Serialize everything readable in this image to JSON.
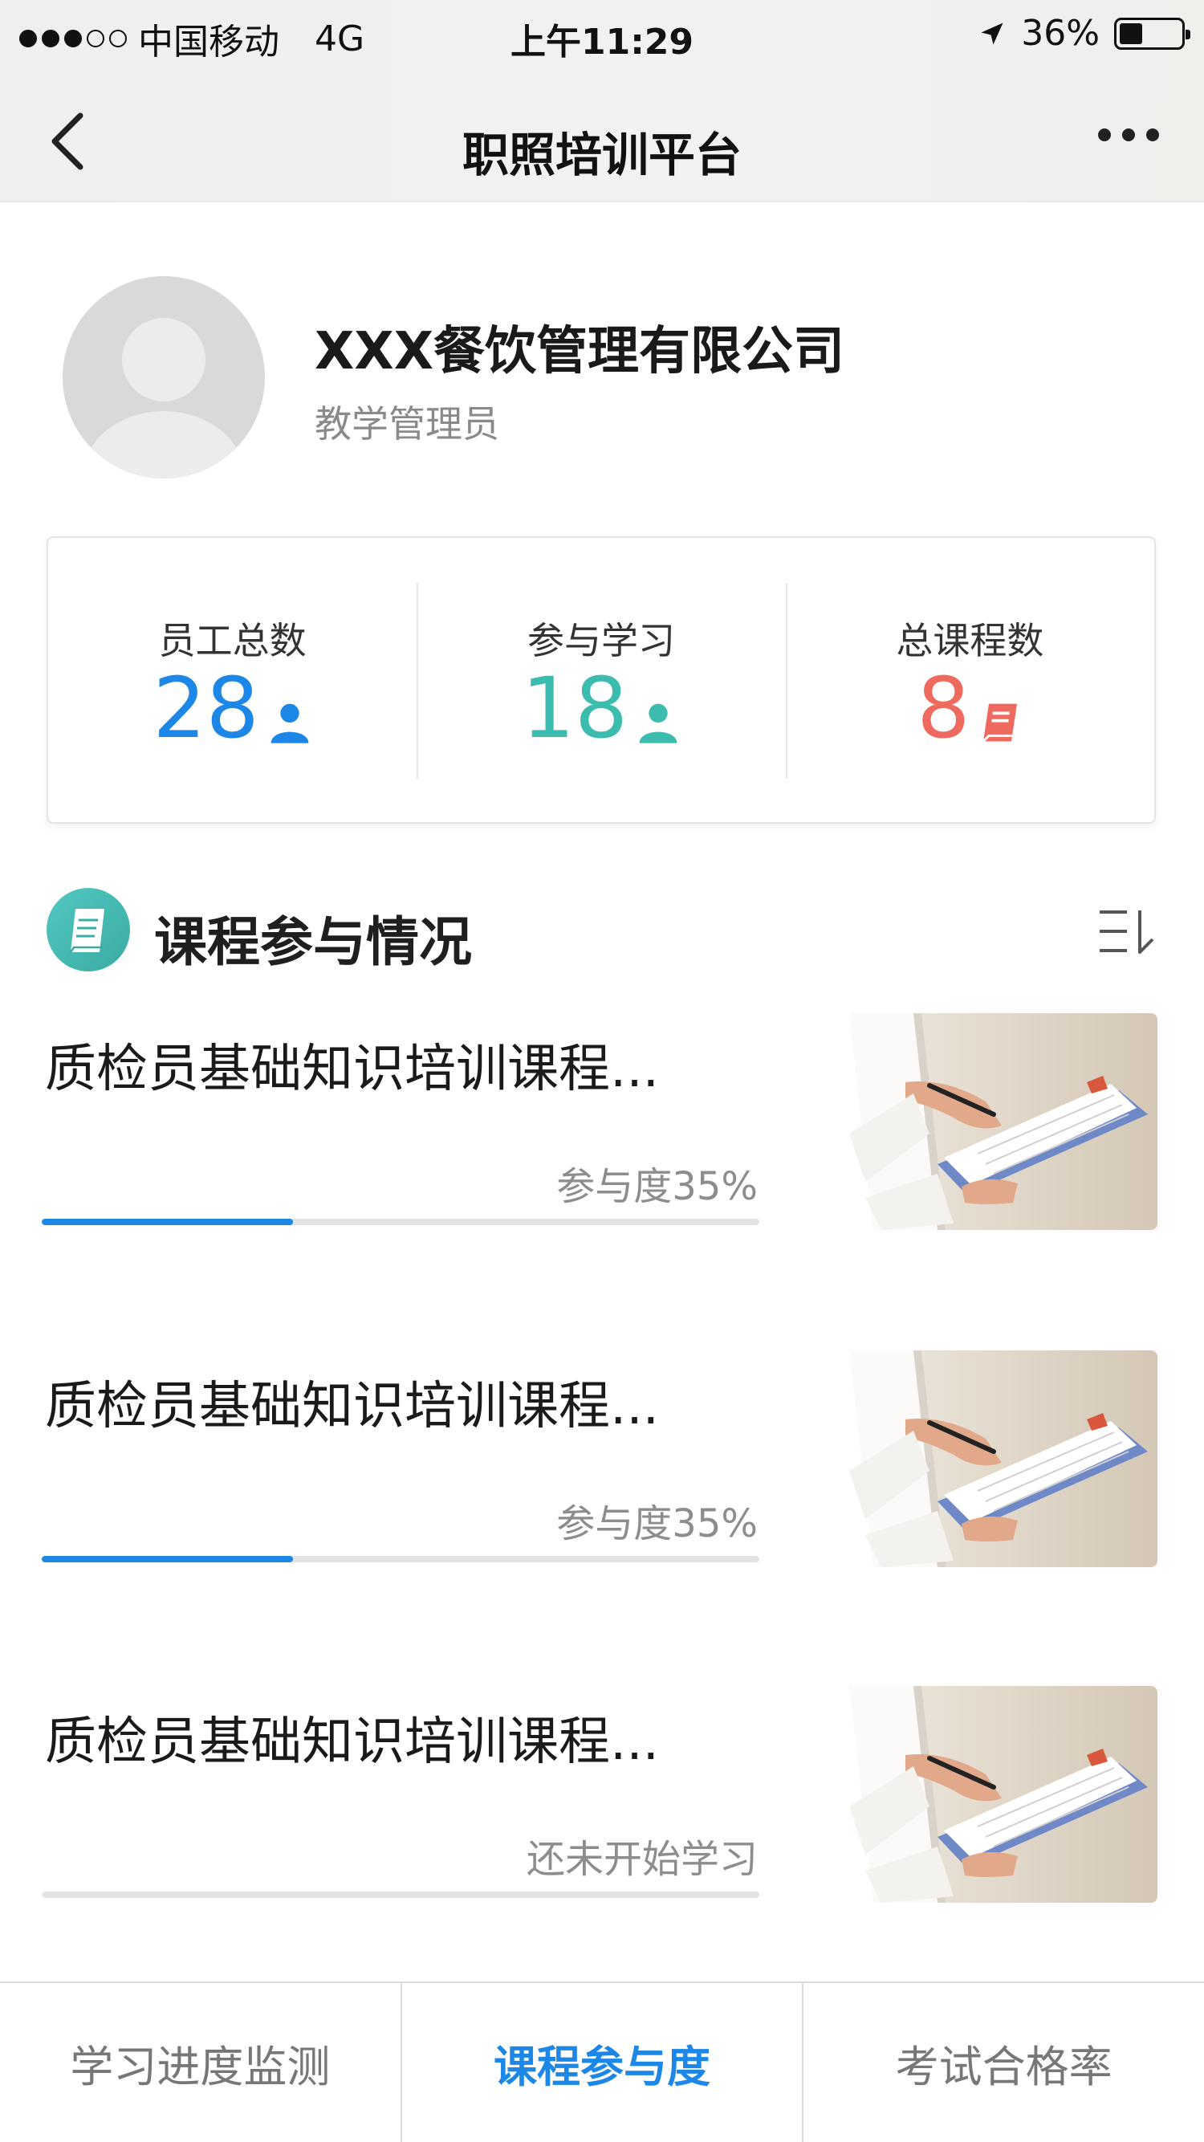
{
  "status_bar": {
    "carrier": "中国移动",
    "network": "4G",
    "time": "上午11:29",
    "battery": "36%",
    "signal_bars": 3,
    "signal_total": 5,
    "battery_level": 0.36
  },
  "nav": {
    "title": "职照培训平台"
  },
  "profile": {
    "company": "XXX餐饮管理有限公司",
    "role": "教学管理员"
  },
  "stats": [
    {
      "label": "员工总数",
      "value": "28",
      "icon": "person-icon",
      "color": "#1c87e6"
    },
    {
      "label": "参与学习",
      "value": "18",
      "icon": "person-icon",
      "color": "#3bbcae"
    },
    {
      "label": "总课程数",
      "value": "8",
      "icon": "book-icon",
      "color": "#ef6a5e"
    }
  ],
  "section": {
    "title": "课程参与情况",
    "icon": "book-icon",
    "sort_icon": "sort-icon"
  },
  "courses": [
    {
      "title": "质检员基础知识培训课程...",
      "status": "参与度35%",
      "progress": 0.35
    },
    {
      "title": "质检员基础知识培训课程...",
      "status": "参与度35%",
      "progress": 0.35
    },
    {
      "title": "质检员基础知识培训课程...",
      "status": "还未开始学习",
      "progress": 0
    }
  ],
  "tabs": [
    {
      "label": "学习进度监测",
      "active": false
    },
    {
      "label": "课程参与度",
      "active": true
    },
    {
      "label": "考试合格率",
      "active": false
    }
  ],
  "colors": {
    "accent_blue": "#1c87e6",
    "teal": "#3bbcae",
    "coral": "#ef6a5e"
  }
}
